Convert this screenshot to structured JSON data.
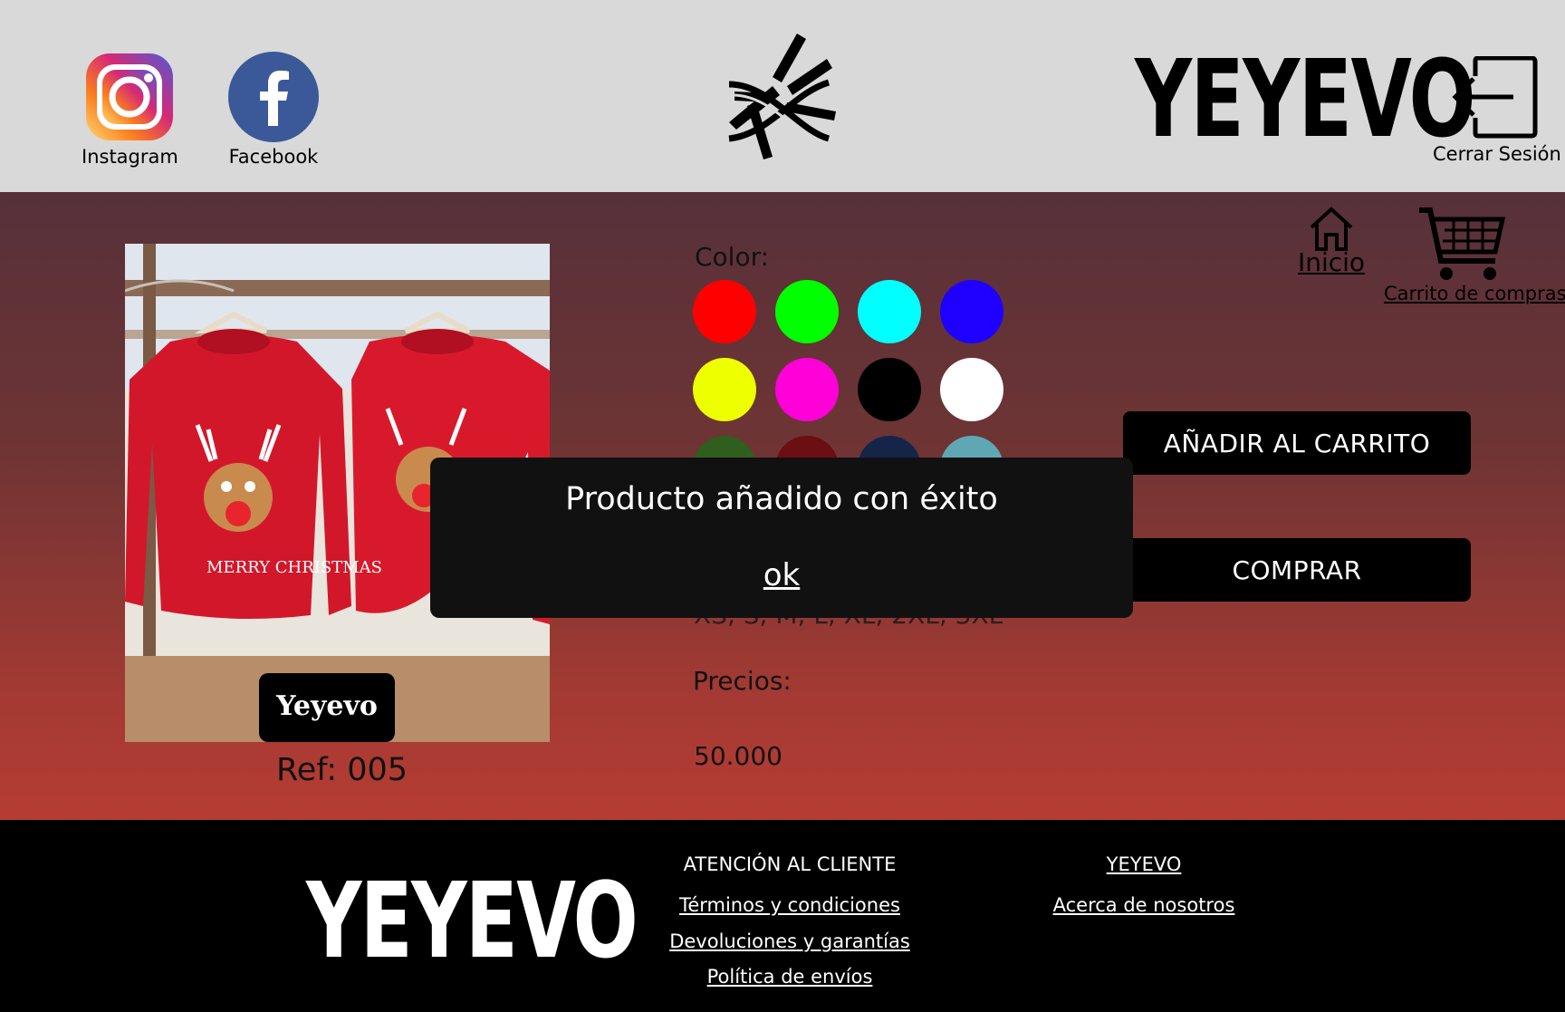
{
  "header": {
    "social": [
      {
        "label": "Instagram",
        "icon": "instagram-icon"
      },
      {
        "label": "Facebook",
        "icon": "facebook-icon"
      }
    ],
    "brand": "YEYEVO",
    "logout_label": "Cerrar Sesión"
  },
  "nav": {
    "home_label": "Inicio",
    "cart_label": "Carrito de compras"
  },
  "product": {
    "image_badge": "Yeyevo",
    "shirt_text": "MERRY CHRISTMAS",
    "ref": "Ref: 005",
    "color_label": "Color:",
    "colors": [
      "#ff0000",
      "#00ff00",
      "#00ffff",
      "#1f00ff",
      "#eeff00",
      "#ff00d9",
      "#000000",
      "#ffffff",
      "#2f5e1e",
      "#6b0f12",
      "#15254a",
      "#5fa8b3"
    ],
    "sizes_text": "XS, S, M, L, XL, 2XL, 3XL",
    "prices_label": "Precios:",
    "price": "50.000"
  },
  "actions": {
    "add_to_cart": "AÑADIR AL CARRITO",
    "buy": "COMPRAR"
  },
  "modal": {
    "message": "Producto añadido con éxito",
    "ok_label": "ok"
  },
  "footer": {
    "brand": "YEYEVO",
    "customer_service": {
      "title": "ATENCIÓN AL CLIENTE",
      "links": [
        "Términos y condiciones",
        "Devoluciones y garantías",
        "Política de envíos"
      ]
    },
    "company": {
      "title": "YEYEVO",
      "links": [
        "Acerca de nosotros"
      ]
    }
  }
}
